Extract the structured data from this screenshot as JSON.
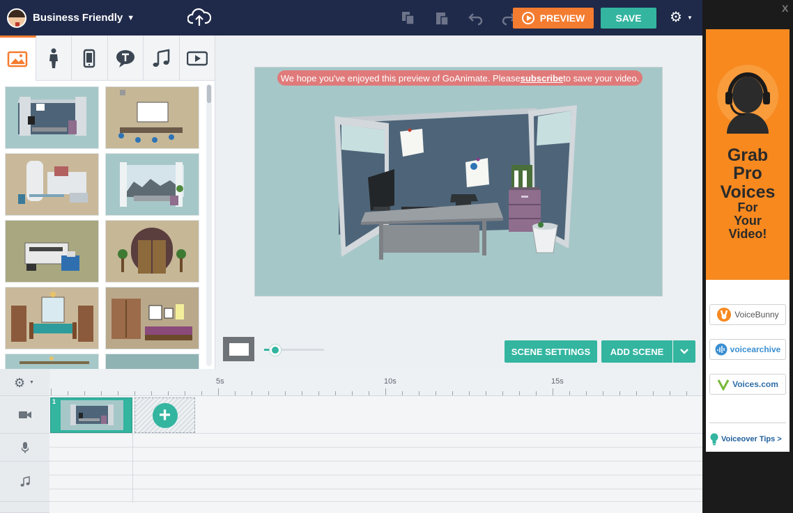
{
  "header": {
    "theme_name": "Business Friendly",
    "preview_label": "PREVIEW",
    "save_label": "SAVE"
  },
  "library": {
    "tabs": [
      {
        "name": "backgrounds",
        "icon": "image-icon",
        "active": true
      },
      {
        "name": "characters",
        "icon": "person-icon",
        "active": false
      },
      {
        "name": "props",
        "icon": "phone-icon",
        "active": false
      },
      {
        "name": "text",
        "icon": "speech-bubble-icon",
        "active": false
      },
      {
        "name": "sound",
        "icon": "music-note-icon",
        "active": false
      },
      {
        "name": "video",
        "icon": "video-play-icon",
        "active": false
      }
    ],
    "thumbnails": [
      "office cubicle",
      "conference room",
      "kitchen",
      "window office",
      "copy room",
      "elevator",
      "dining room",
      "bedroom",
      "lobby",
      "hallway"
    ]
  },
  "stage": {
    "banner_prefix": "We hope you've enjoyed this preview of GoAnimate. Please ",
    "banner_link": "subscribe",
    "banner_suffix": " to save your video."
  },
  "controls": {
    "scene_settings_label": "SCENE SETTINGS",
    "add_scene_label": "ADD SCENE",
    "zoom_level": 0.2
  },
  "timeline": {
    "ticks": [
      "5s",
      "10s",
      "15s"
    ],
    "scene_number": "1",
    "tracks": [
      "video-camera-icon",
      "microphone-icon",
      "music-note-icon"
    ]
  },
  "ad": {
    "headline_1": "Grab",
    "headline_2": "Pro",
    "headline_3": "Voices",
    "headline_4": "For",
    "headline_5": "Your",
    "headline_6": "Video!",
    "vendors": [
      "VoiceBunny",
      "voicearchive",
      "Voices.com"
    ],
    "tips_label": "Voiceover Tips >",
    "close_label": "X"
  },
  "colors": {
    "nav_bg": "#1f2a4a",
    "accent_orange": "#f47c30",
    "accent_teal": "#33b5a0",
    "stage_bg": "#a6c7c8"
  }
}
